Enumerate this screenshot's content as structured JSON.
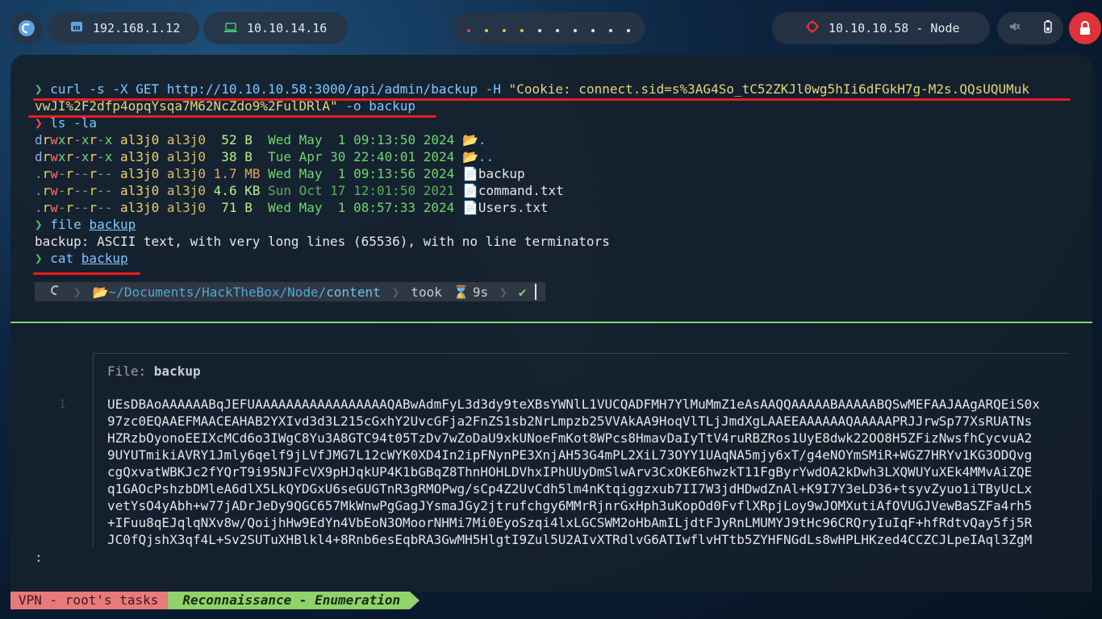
{
  "topbar": {
    "local_ip": "192.168.1.12",
    "vpn_ip": "10.10.14.16",
    "target": "10.10.10.58 - Node",
    "workspace_dots": [
      "#e04a4a",
      "#e8c23a",
      "#e8c23a",
      "#e8c23a",
      "#e6e9ef",
      "#e6e9ef",
      "#e6e9ef",
      "#e6e9ef",
      "#e6e9ef",
      "#e6e9ef"
    ]
  },
  "terminal": {
    "cmd1_a": "curl -s -X GET http://10.10.10.58:3000/api/admin/backup -H ",
    "cmd1_b": "\"Cookie: connect.sid=s%3AG4So_tC52ZKJl0wg5hIi6dFGkH7g-M2s.QQsUQUMuk",
    "cmd1_c": "vwJI%2F2dfp4opqYsqa7M62NcZdo9%2FulDRlA\"",
    "cmd1_d": " -o backup",
    "cmd2": "ls -la",
    "ls_rows": [
      {
        "perm": "drwxr-xr-x",
        "owner": "al3j0",
        "group": "al3j0",
        "size": " 52 B ",
        "date": "Wed May  1 09:13:50 2024",
        "name": "."
      },
      {
        "perm": "drwxr-xr-x",
        "owner": "al3j0",
        "group": "al3j0",
        "size": " 38 B ",
        "date": "Tue Apr 30 22:40:01 2024",
        "name": ".."
      },
      {
        "perm": ".rw-r--r--",
        "owner": "al3j0",
        "group": "al3j0",
        "size": "1.7 MB",
        "date": "Wed May  1 09:13:56 2024",
        "name": "backup"
      },
      {
        "perm": ".rw-r--r--",
        "owner": "al3j0",
        "group": "al3j0",
        "size": "4.6 KB",
        "date": "Sun Oct 17 12:01:50 2021",
        "name": "command.txt"
      },
      {
        "perm": ".rw-r--r--",
        "owner": "al3j0",
        "group": "al3j0",
        "size": " 71 B ",
        "date": "Wed May  1 08:57:33 2024",
        "name": "Users.txt"
      }
    ],
    "cmd3_a": "file ",
    "cmd3_b": "backup",
    "file_output": "backup: ASCII text, with very long lines (65536), with no line terminators",
    "cmd4_a": "cat ",
    "cmd4_b": "backup",
    "prompt_path_prefix": "~/Documents/HackTheBox/Node/",
    "prompt_path_dir": "content",
    "prompt_took": "took",
    "prompt_time": "9s",
    "prompt_check": "✔"
  },
  "bat": {
    "file_label": "File: ",
    "file_name": "backup",
    "line_number": "1",
    "content_lines": [
      "UEsDBAoAAAAAABqJEFUAAAAAAAAAAAAAAAAAQABwAdmFyL3d3dy9teXBsYWNlL1VUCQADFMH7YlMuMmZ1eAsAAQQAAAAABAAAAABQSwMEFAAJAAgARQEiS0x",
      "97zc0EQAAEFMAACEAHAB2YXIvd3d3L215cGxhY2UvcGFja2FnZS1sb2NrLmpzb25VVAkAA9HoqVlTLjJmdXgLAAEEAAAAAAQAAAAAPRJJrwSp77XsRUATNs",
      "HZRzbOyonoEEIXcMCd6o3IWgC8Yu3A8GTC94t05TzDv7wZoDaU9xkUNoeFmKot8WPcs8HmavDaIyTtV4ruRBZRos1UyE8dwk22OO8H5ZFizNwsfhCycvuA2",
      "9UYUTmikiAVRY1Jmly6qelf9jLVfJMG7L12cWYK0XD4In2ipFNynPE3XnjAH53G4mPL2XiL73OYY1UAqNA5mjy6xT/g4eNOYmSMiR+WGZ7HRYv1KG3ODQvg",
      "cgQxvatWBKJc2fYQrT9i95NJFcVX9pHJqkUP4K1bGBqZ8ThnHOHLDVhxIPhUUyDmSlwArv3CxOKE6hwzkT11FgByrYwdOA2kDwh3LXQWUYuXEk4MMvAiZQE",
      "q1GAOcPshzbDMleA6dlX5LkQYDGxU6seGUGTnR3gRMOPwg/sCp4Z2UvCdh5lm4nKtqiggzxub7II7W3jdHDwdZnAl+K9I7Y3eLD36+tsyvZyuo1iTByUcLx",
      "vetYsO4yAbh+w77jADrJeDy9QGC657MkWnwPgGagJYsmaJGy2jtrufchgy6MMrRjnrGxHph3uKopOd0FvflXRpjLoy9wJOMXutiAfOVUGJVewBaSZFa4rh5",
      "+IFuu8qEJqlqNXv8w/QoijhHw9EdYn4VbEoN3OMoorNHMi7Mi0EyoSzqi4lxLGCSWM2oHbAmILjdtFJyRnLMUMYJ9tHc96CRQryIuIqF+hfRdtvQay5fj5R",
      "JC0fQjshX3qf4L+Sv2SUTuXHBlkl4+8Rnb6esEqbRA3GwMH5HlgtI9Zul5U2AIvXTRdlvG6ATIwflvHTtb5ZYHFNGdLs8wHPLHKzed4CCZCJLpeIAql3ZgM"
    ],
    "pager_prompt": ":"
  },
  "statusbar": {
    "session": "VPN - root's tasks",
    "window": "Reconnaissance - Enumeration"
  }
}
